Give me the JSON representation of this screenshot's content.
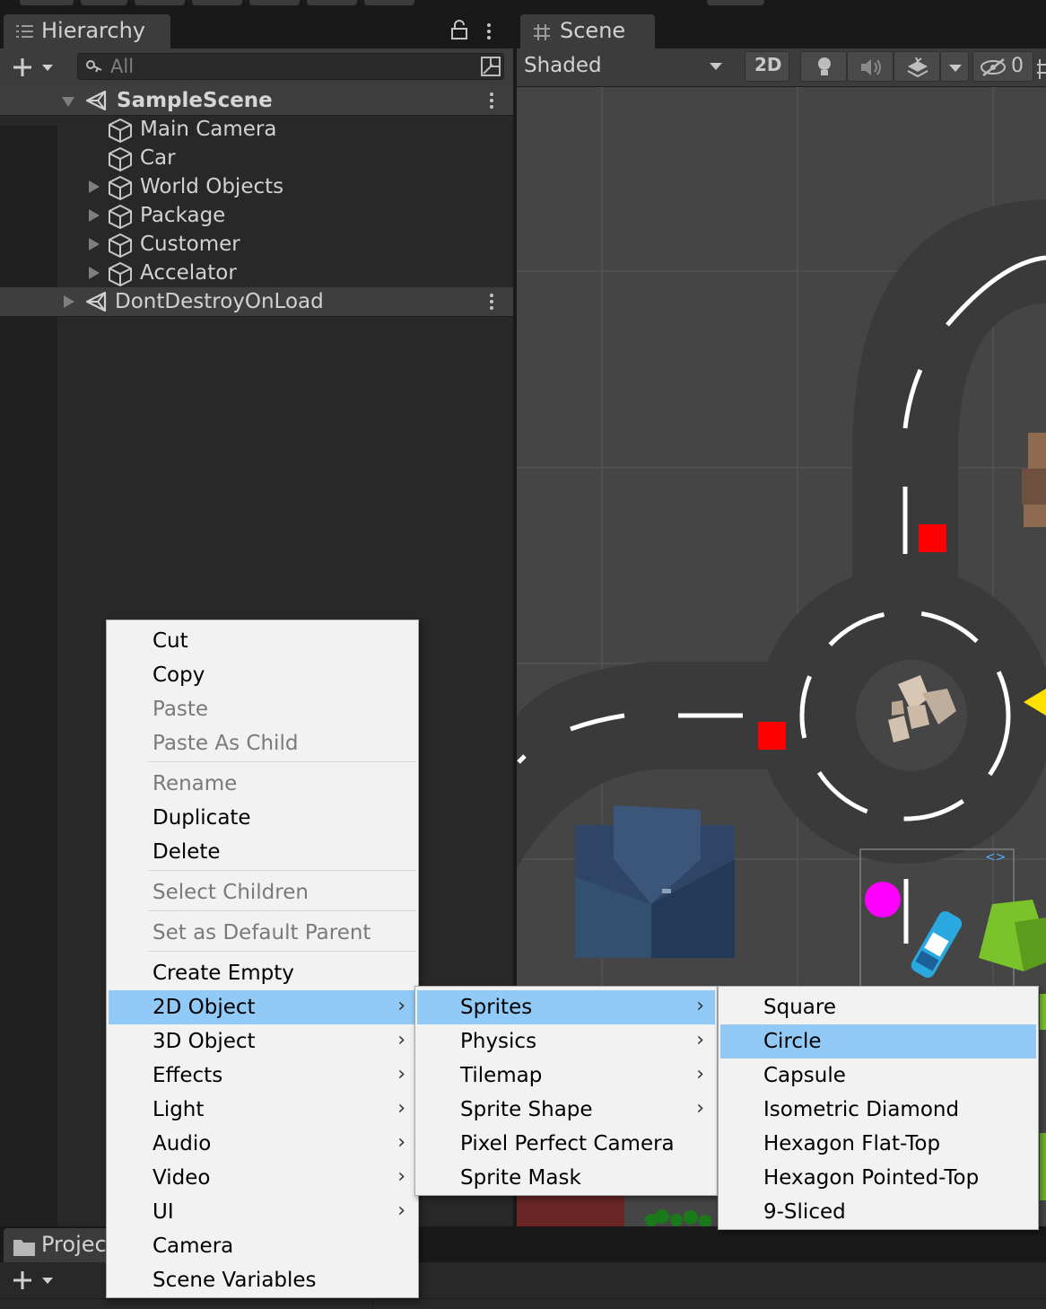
{
  "hierarchy": {
    "tab_label": "Hierarchy",
    "search_placeholder": "All",
    "scene_name": "SampleScene",
    "items": [
      {
        "label": "Main Camera",
        "has_children": false
      },
      {
        "label": "Car",
        "has_children": false
      },
      {
        "label": "World Objects",
        "has_children": true
      },
      {
        "label": "Package",
        "has_children": true
      },
      {
        "label": "Customer",
        "has_children": true
      },
      {
        "label": "Accelator",
        "has_children": true
      }
    ],
    "dont_destroy": "DontDestroyOnLoad"
  },
  "scene": {
    "tab_label": "Scene",
    "shading_mode": "Shaded",
    "toggle_2d": "2D",
    "hidden_count": "0"
  },
  "project": {
    "tab_label": "Project",
    "visible_fragment": "Projec"
  },
  "context_menu": {
    "items": [
      "Cut",
      "Copy",
      "Paste",
      "Paste As Child",
      "Rename",
      "Duplicate",
      "Delete",
      "Select Children",
      "Set as Default Parent",
      "Create Empty",
      "2D Object",
      "3D Object",
      "Effects",
      "Light",
      "Audio",
      "Video",
      "UI",
      "Camera",
      "Scene Variables"
    ],
    "disabled": [
      "Paste",
      "Paste As Child",
      "Rename",
      "Select Children",
      "Set as Default Parent"
    ],
    "highlighted": "2D Object"
  },
  "submenu_2d": {
    "items": [
      "Sprites",
      "Physics",
      "Tilemap",
      "Sprite Shape",
      "Pixel Perfect Camera",
      "Sprite Mask"
    ],
    "highlighted": "Sprites"
  },
  "submenu_sprites": {
    "items": [
      "Square",
      "Circle",
      "Capsule",
      "Isometric Diamond",
      "Hexagon Flat-Top",
      "Hexagon Pointed-Top",
      "9-Sliced"
    ],
    "highlighted": "Circle"
  },
  "colors": {
    "menu_highlight": "#91c9f7",
    "marker_red": "#ff0000",
    "marker_magenta": "#ff00ff"
  }
}
